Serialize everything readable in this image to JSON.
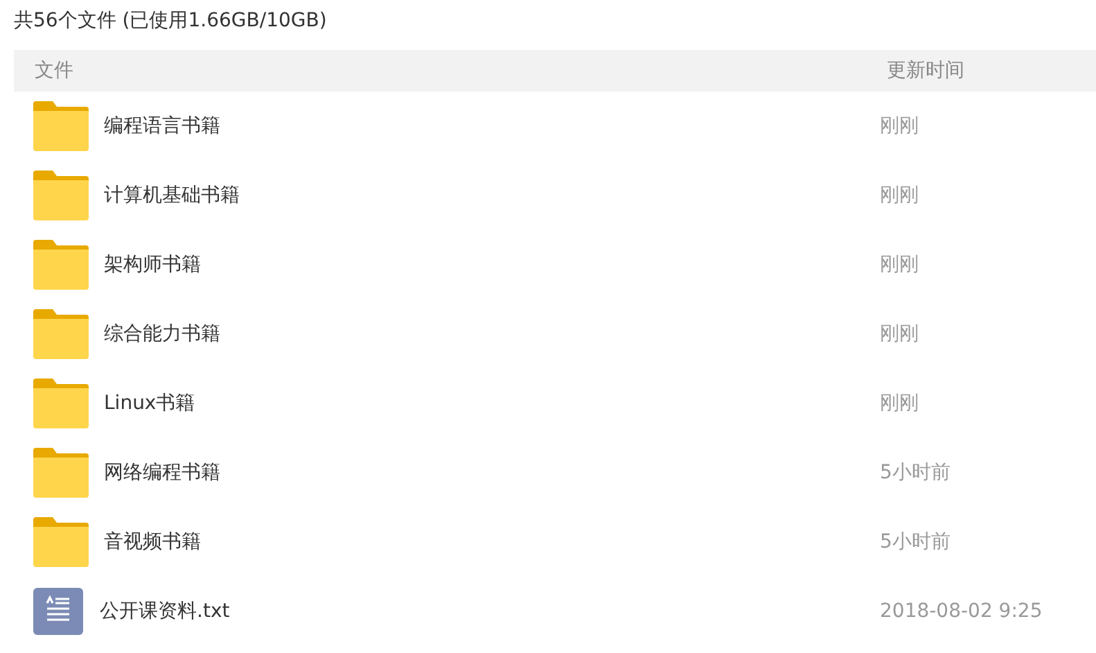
{
  "summary": "共56个文件 (已使用1.66GB/10GB)",
  "table": {
    "columns": [
      "文件",
      "更新时间"
    ],
    "rows": [
      {
        "kind": "folder",
        "name": "编程语言书籍",
        "updated": "刚刚"
      },
      {
        "kind": "folder",
        "name": "计算机基础书籍",
        "updated": "刚刚"
      },
      {
        "kind": "folder",
        "name": "架构师书籍",
        "updated": "刚刚"
      },
      {
        "kind": "folder",
        "name": "综合能力书籍",
        "updated": "刚刚"
      },
      {
        "kind": "folder",
        "name": "Linux书籍",
        "updated": "刚刚"
      },
      {
        "kind": "folder",
        "name": "网络编程书籍",
        "updated": "5小时前"
      },
      {
        "kind": "folder",
        "name": "音视频书籍",
        "updated": "5小时前"
      },
      {
        "kind": "text",
        "name": "公开课资料.txt",
        "updated": "2018-08-02 9:25"
      }
    ]
  }
}
